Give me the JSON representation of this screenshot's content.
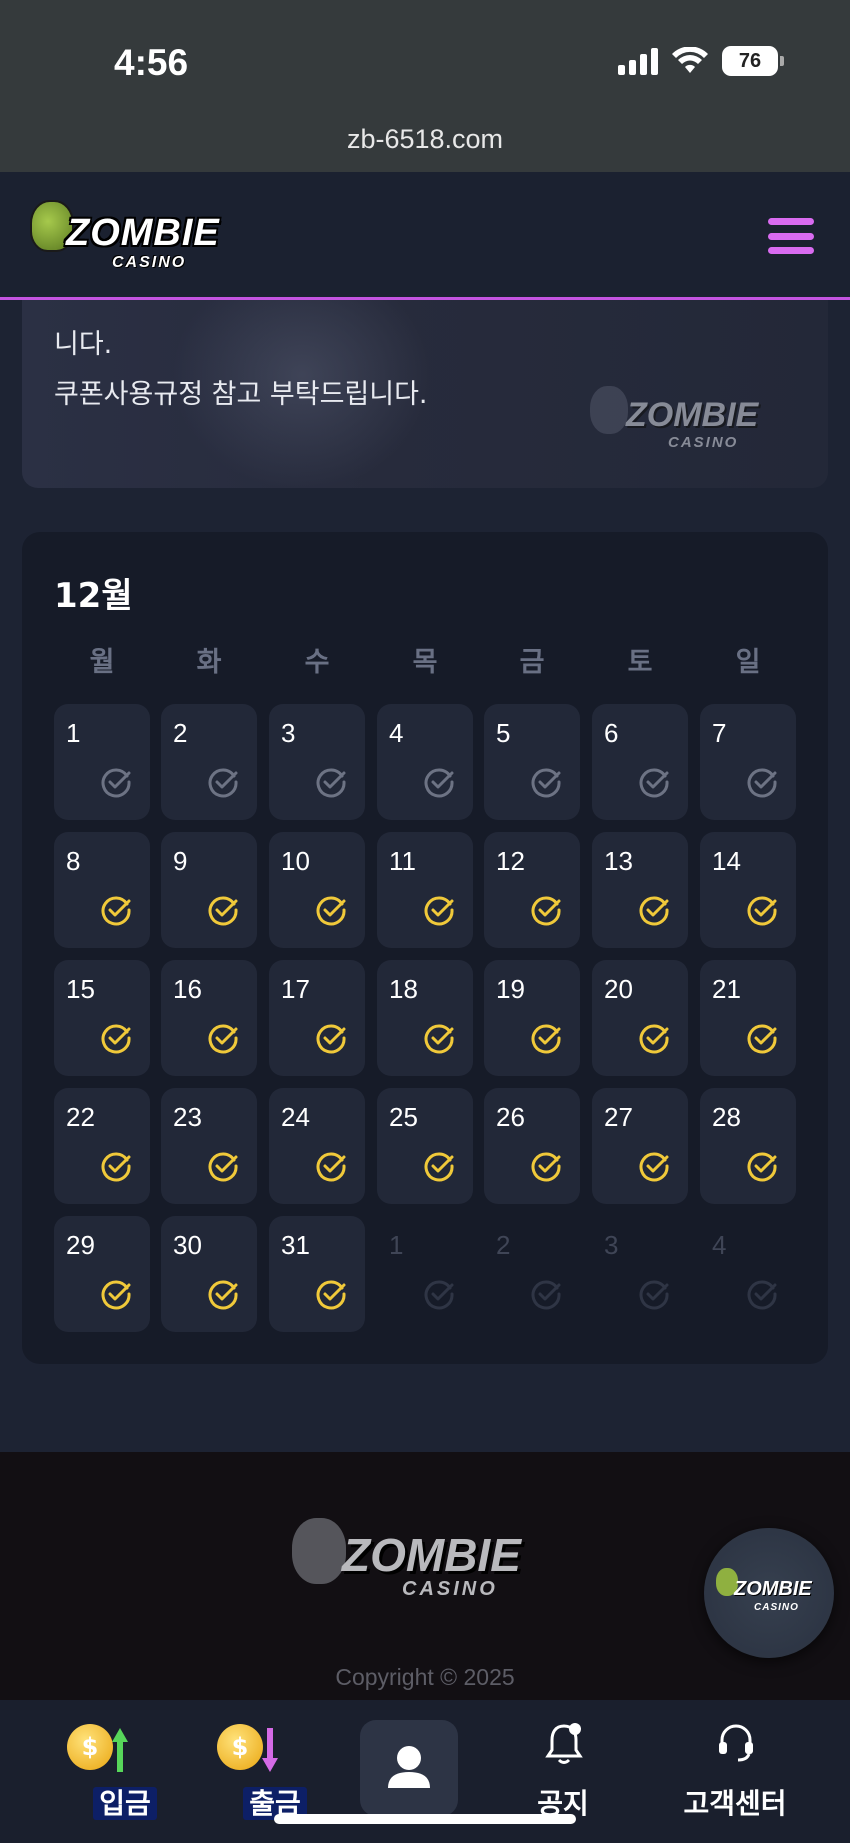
{
  "status_bar": {
    "time": "4:56",
    "battery": "76",
    "url": "zb-6518.com"
  },
  "header": {
    "logo_text": "ZOMBIE",
    "logo_sub": "CASINO",
    "menu_icon": "hamburger-icon",
    "accent_color": "#d96bf0"
  },
  "notice": {
    "line1": "니다.",
    "line2": "쿠폰사용규정 참고 부탁드립니다.",
    "logo_text": "ZOMBIE",
    "logo_sub": "CASINO"
  },
  "calendar": {
    "month_label": "12월",
    "weekdays": [
      "월",
      "화",
      "수",
      "목",
      "금",
      "토",
      "일"
    ],
    "check_colors": {
      "checked": "#f0c93a",
      "unchecked": "#6d7384",
      "muted": "#2f3545"
    },
    "days": [
      {
        "num": "1",
        "state": "unchecked"
      },
      {
        "num": "2",
        "state": "unchecked"
      },
      {
        "num": "3",
        "state": "unchecked"
      },
      {
        "num": "4",
        "state": "unchecked"
      },
      {
        "num": "5",
        "state": "unchecked"
      },
      {
        "num": "6",
        "state": "unchecked"
      },
      {
        "num": "7",
        "state": "unchecked"
      },
      {
        "num": "8",
        "state": "checked"
      },
      {
        "num": "9",
        "state": "checked"
      },
      {
        "num": "10",
        "state": "checked"
      },
      {
        "num": "11",
        "state": "checked"
      },
      {
        "num": "12",
        "state": "checked"
      },
      {
        "num": "13",
        "state": "checked"
      },
      {
        "num": "14",
        "state": "checked"
      },
      {
        "num": "15",
        "state": "checked"
      },
      {
        "num": "16",
        "state": "checked"
      },
      {
        "num": "17",
        "state": "checked"
      },
      {
        "num": "18",
        "state": "checked"
      },
      {
        "num": "19",
        "state": "checked"
      },
      {
        "num": "20",
        "state": "checked"
      },
      {
        "num": "21",
        "state": "checked"
      },
      {
        "num": "22",
        "state": "checked"
      },
      {
        "num": "23",
        "state": "checked"
      },
      {
        "num": "24",
        "state": "checked"
      },
      {
        "num": "25",
        "state": "checked"
      },
      {
        "num": "26",
        "state": "checked"
      },
      {
        "num": "27",
        "state": "checked"
      },
      {
        "num": "28",
        "state": "checked"
      },
      {
        "num": "29",
        "state": "checked"
      },
      {
        "num": "30",
        "state": "checked"
      },
      {
        "num": "31",
        "state": "checked"
      },
      {
        "num": "1",
        "state": "muted"
      },
      {
        "num": "2",
        "state": "muted"
      },
      {
        "num": "3",
        "state": "muted"
      },
      {
        "num": "4",
        "state": "muted"
      }
    ]
  },
  "footer": {
    "logo_text": "ZOMBIE",
    "logo_sub": "CASINO",
    "copyright": "Copyright © 2025"
  },
  "float_button": {
    "logo_text": "ZOMBIE",
    "logo_sub": "CASINO"
  },
  "bottom_nav": {
    "deposit": "입금",
    "withdraw": "출금",
    "profile_icon": "user-icon",
    "notice": "공지",
    "support": "고객센터"
  }
}
